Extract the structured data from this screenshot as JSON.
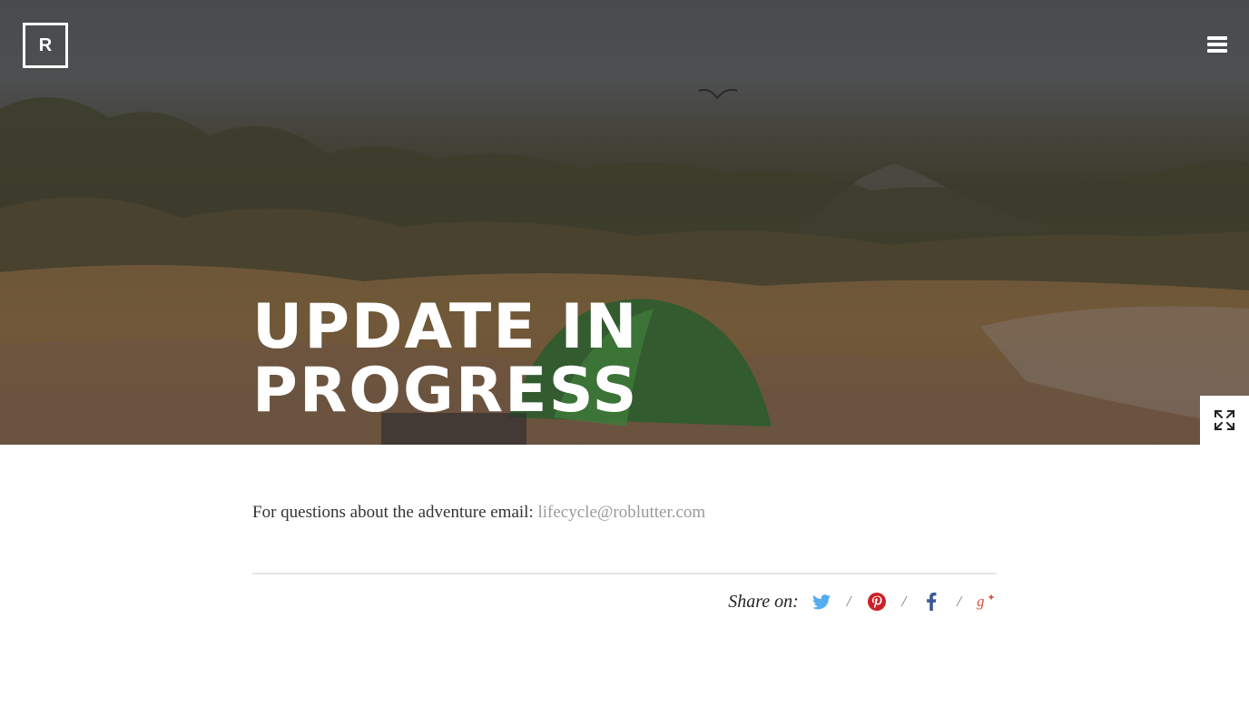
{
  "header": {
    "logo_text": "R",
    "menu_icon": "hamburger-icon"
  },
  "hero": {
    "title_line1": "UPDATE IN",
    "title_line2": "PROGRESS",
    "expand_icon": "expand-icon"
  },
  "content": {
    "contact_text": "For questions about the adventure email:",
    "contact_email": "lifecycle@roblutter.com"
  },
  "share": {
    "label": "Share on:",
    "separator": "/",
    "networks": [
      {
        "name": "Twitter",
        "icon": "twitter-icon",
        "color": "#55acee"
      },
      {
        "name": "Pinterest",
        "icon": "pinterest-icon",
        "color": "#cb2027"
      },
      {
        "name": "Facebook",
        "icon": "facebook-icon",
        "color": "#3b5998"
      },
      {
        "name": "Google+",
        "icon": "google-plus-icon",
        "color": "#dd4b39"
      }
    ]
  },
  "colors": {
    "link": "#9a9a9a",
    "text": "#333333",
    "divider": "#e6e6e6"
  }
}
